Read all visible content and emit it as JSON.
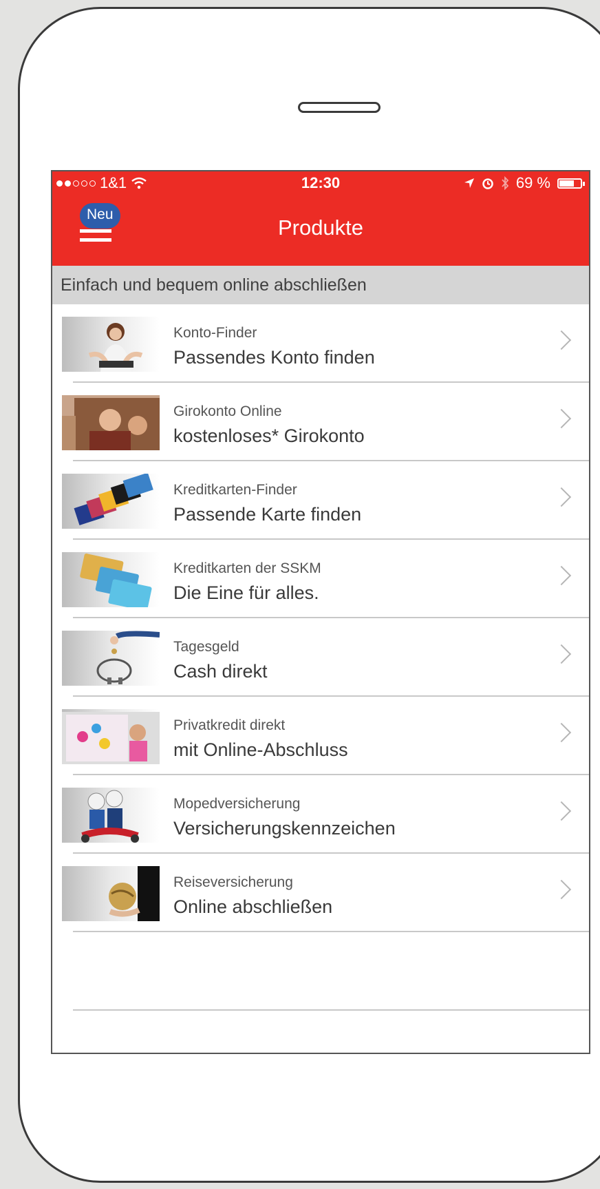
{
  "status": {
    "carrier": "1&1",
    "time": "12:30",
    "battery": "69 %",
    "battery_level": 0.69
  },
  "nav": {
    "badge": "Neu",
    "title": "Produkte",
    "menu_icon": "hamburger-menu-icon"
  },
  "section_header": "Einfach und bequem online abschließen",
  "items": [
    {
      "subtitle": "Konto-Finder",
      "title": "Passendes Konto finden",
      "thumb": "woman-laptop"
    },
    {
      "subtitle": "Girokonto Online",
      "title": "kostenloses* Girokonto",
      "thumb": "photo-people"
    },
    {
      "subtitle": "Kreditkarten-Finder",
      "title": "Passende Karte finden",
      "thumb": "card-fan"
    },
    {
      "subtitle": "Kreditkarten der SSKM",
      "title": "Die Eine für alles.",
      "thumb": "credit-cards"
    },
    {
      "subtitle": "Tagesgeld",
      "title": "Cash direkt",
      "thumb": "piggy-bank"
    },
    {
      "subtitle": "Privatkredit direkt",
      "title": "mit Online-Abschluss",
      "thumb": "child-painting"
    },
    {
      "subtitle": "Mopedversicherung",
      "title": "Versicherungskennzeichen",
      "thumb": "scooter-couple"
    },
    {
      "subtitle": "Reiseversicherung",
      "title": "Online abschließen",
      "thumb": "globe-hand"
    }
  ],
  "colors": {
    "brand_red": "#ec2c25",
    "badge_blue": "#2e5dab",
    "section_gray": "#d5d5d5"
  }
}
